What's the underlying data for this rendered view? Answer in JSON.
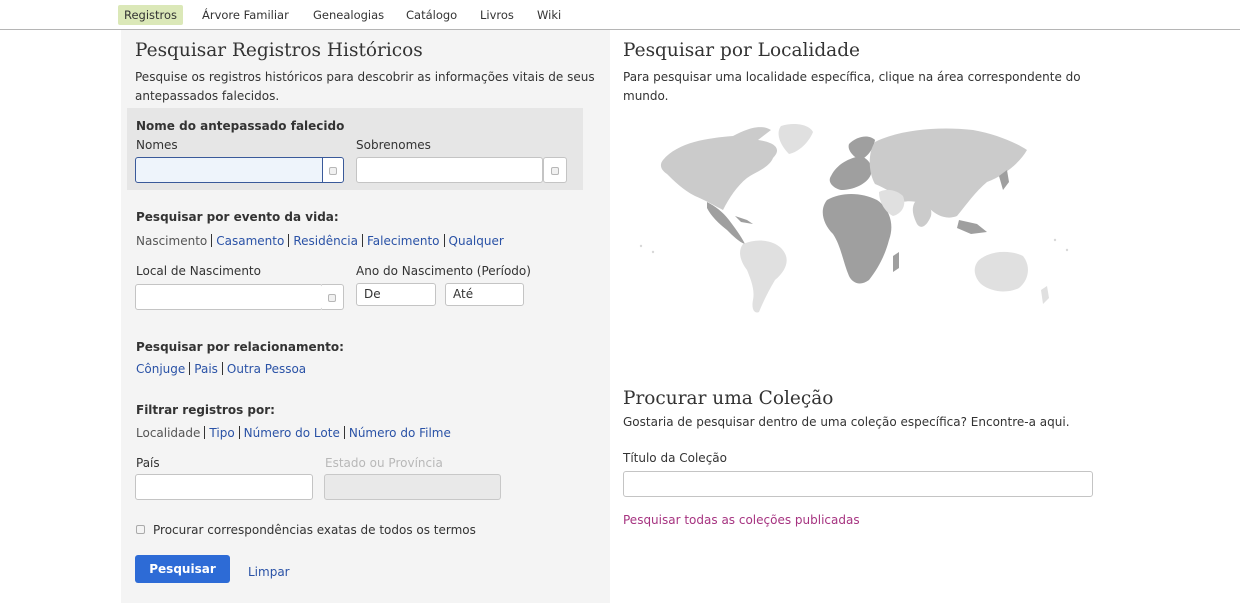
{
  "nav": {
    "tabs": [
      "Registros",
      "Árvore Familiar",
      "Genealogias",
      "Catálogo",
      "Livros",
      "Wiki"
    ],
    "active": "Registros"
  },
  "search": {
    "title": "Pesquisar Registros Históricos",
    "description_line1": "Pesquise os registros históricos para descobrir as informações vitais de seus",
    "description_line2": "antepassados falecidos.",
    "ancestor_heading": "Nome do antepassado falecido",
    "first_names_label": "Nomes",
    "first_names_value": "",
    "last_names_label": "Sobrenomes",
    "last_names_value": "",
    "life_event_heading": "Pesquisar por evento da vida:",
    "life_events": [
      "Nascimento",
      "Casamento",
      "Residência",
      "Falecimento",
      "Qualquer"
    ],
    "birth_place_label": "Local de Nascimento",
    "birth_place_value": "",
    "birth_year_label": "Ano do Nascimento (Período)",
    "year_from_placeholder": "De",
    "year_to_placeholder": "Até",
    "relationship_heading": "Pesquisar por relacionamento:",
    "relationships": [
      "Cônjuge",
      "Pais",
      "Outra Pessoa"
    ],
    "filter_heading": "Filtrar registros por:",
    "filters": [
      "Localidade",
      "Tipo",
      "Número do Lote",
      "Número do Filme"
    ],
    "country_label": "País",
    "state_label": "Estado ou Província",
    "exact_match_label": "Procurar correspondências exatas de todos os termos",
    "exact_match_checked": false,
    "search_button": "Pesquisar",
    "clear_link": "Limpar"
  },
  "locality": {
    "title": "Pesquisar por Localidade",
    "description_line1": "Para pesquisar uma localidade específica, clique na área correspondente do",
    "description_line2": "mundo.",
    "map_icon": "world-map-icon"
  },
  "collection": {
    "title": "Procurar uma Coleção",
    "description": "Gostaria de pesquisar dentro de uma coleção específica? Encontre-a aqui.",
    "title_label": "Título da Coleção",
    "title_value": "",
    "all_collections_link": "Pesquisar todas as coleções publicadas"
  },
  "colors": {
    "active_tab": "#dbe8b8",
    "link": "#2a52a6",
    "primary_button": "#2d6bd6",
    "accent_link": "#a63380"
  }
}
